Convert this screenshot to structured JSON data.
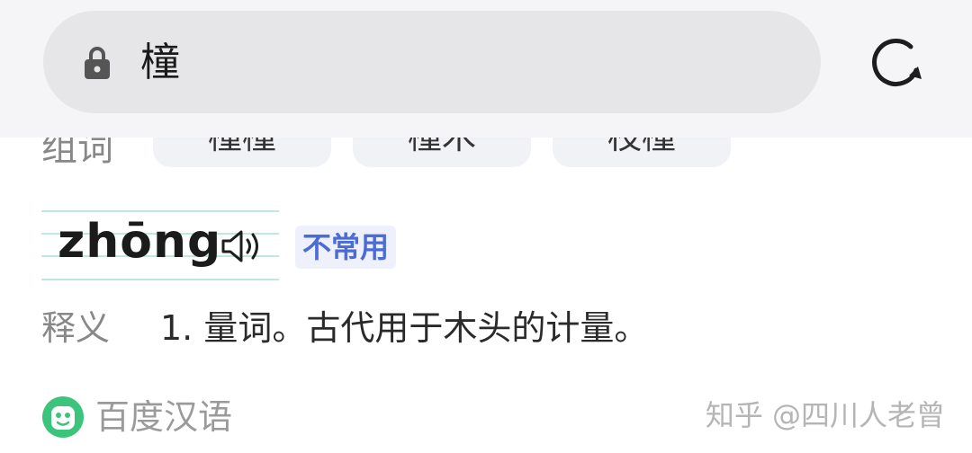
{
  "address_bar": {
    "query": "橦",
    "lock_icon": "lock-icon",
    "reload_icon": "reload-icon"
  },
  "related": {
    "label": "组词",
    "chips": [
      "橦橦",
      "橦木",
      "枝橦"
    ]
  },
  "entry": {
    "pinyin": "zhōng",
    "speaker_icon": "speaker-icon",
    "badge": "不常用",
    "definition_label": "释义",
    "definition": "1. 量词。古代用于木头的计量。"
  },
  "source": {
    "name": "百度汉语",
    "logo_icon": "baidu-hanyu-logo"
  },
  "watermark": "知乎 @四川人老曾",
  "colors": {
    "badge_text": "#4b6bd6",
    "badge_bg": "#eef1fb",
    "pinyin_grid": "#bfe7df",
    "source_logo": "#3cc47c"
  }
}
